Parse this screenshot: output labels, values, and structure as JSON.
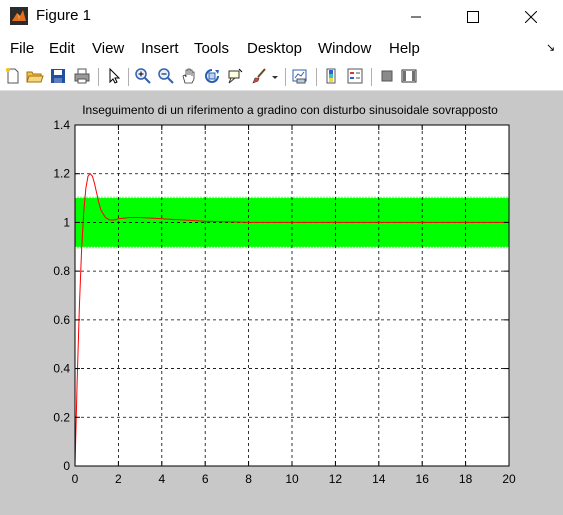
{
  "window": {
    "title": "Figure 1"
  },
  "menu": {
    "items": [
      "File",
      "Edit",
      "View",
      "Insert",
      "Tools",
      "Desktop",
      "Window",
      "Help"
    ]
  },
  "toolbar": {
    "icons": [
      "new-figure-icon",
      "open-file-icon",
      "save-icon",
      "print-icon",
      "pointer-icon",
      "zoom-in-icon",
      "zoom-out-icon",
      "pan-icon",
      "rotate-3d-icon",
      "data-cursor-icon",
      "brush-icon",
      "link-plot-icon",
      "colorbar-icon",
      "legend-icon",
      "hide-plot-tools-icon",
      "show-plot-tools-icon"
    ]
  },
  "colors": {
    "response": "#ff0000",
    "disturbance": "#00ff00",
    "figure_bg": "#c8c8c8"
  },
  "chart_data": {
    "type": "line",
    "title": "Inseguimento di un riferimento a gradino con disturbo sinusoidale sovrapposto",
    "xlabel": "",
    "ylabel": "",
    "xlim": [
      0,
      20
    ],
    "ylim": [
      0,
      1.4
    ],
    "x_ticks": [
      "0",
      "2",
      "4",
      "6",
      "8",
      "10",
      "12",
      "14",
      "16",
      "18",
      "20"
    ],
    "y_ticks": [
      "0",
      "0.2",
      "0.4",
      "0.6",
      "0.8",
      "1",
      "1.2",
      "1.4"
    ],
    "grid": true,
    "series": [
      {
        "color": "#00ff00",
        "kind": "band",
        "x": [
          0,
          20
        ],
        "y_low": 0.9,
        "y_high": 1.1
      },
      {
        "color": "#ff0000",
        "kind": "line",
        "x": [
          0,
          0.1,
          0.2,
          0.3,
          0.4,
          0.5,
          0.6,
          0.7,
          0.8,
          0.9,
          1.0,
          1.1,
          1.2,
          1.4,
          1.6,
          1.8,
          2.0,
          2.5,
          3.0,
          4.0,
          5.0,
          6.0,
          7.0,
          8.0,
          10.0,
          12.0,
          14.0,
          16.0,
          18.0,
          20.0
        ],
        "y": [
          0,
          0.35,
          0.65,
          0.88,
          1.04,
          1.14,
          1.19,
          1.2,
          1.19,
          1.16,
          1.12,
          1.08,
          1.05,
          1.02,
          1.01,
          1.01,
          1.015,
          1.02,
          1.02,
          1.015,
          1.01,
          1.005,
          1.003,
          1.0,
          1.0,
          1.0,
          1.0,
          1.0,
          1.0,
          1.0
        ]
      }
    ]
  }
}
